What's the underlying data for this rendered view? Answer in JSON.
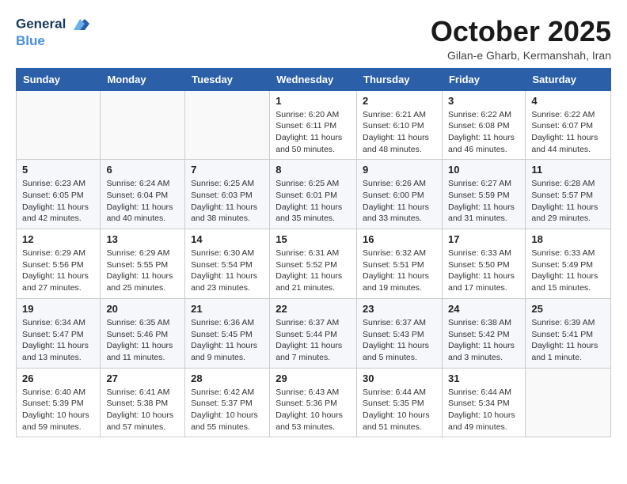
{
  "header": {
    "logo_line1": "General",
    "logo_line2": "Blue",
    "title": "October 2025",
    "subtitle": "Gilan-e Gharb, Kermanshah, Iran"
  },
  "weekdays": [
    "Sunday",
    "Monday",
    "Tuesday",
    "Wednesday",
    "Thursday",
    "Friday",
    "Saturday"
  ],
  "weeks": [
    [
      {
        "day": "",
        "info": ""
      },
      {
        "day": "",
        "info": ""
      },
      {
        "day": "",
        "info": ""
      },
      {
        "day": "1",
        "info": "Sunrise: 6:20 AM\nSunset: 6:11 PM\nDaylight: 11 hours\nand 50 minutes."
      },
      {
        "day": "2",
        "info": "Sunrise: 6:21 AM\nSunset: 6:10 PM\nDaylight: 11 hours\nand 48 minutes."
      },
      {
        "day": "3",
        "info": "Sunrise: 6:22 AM\nSunset: 6:08 PM\nDaylight: 11 hours\nand 46 minutes."
      },
      {
        "day": "4",
        "info": "Sunrise: 6:22 AM\nSunset: 6:07 PM\nDaylight: 11 hours\nand 44 minutes."
      }
    ],
    [
      {
        "day": "5",
        "info": "Sunrise: 6:23 AM\nSunset: 6:05 PM\nDaylight: 11 hours\nand 42 minutes."
      },
      {
        "day": "6",
        "info": "Sunrise: 6:24 AM\nSunset: 6:04 PM\nDaylight: 11 hours\nand 40 minutes."
      },
      {
        "day": "7",
        "info": "Sunrise: 6:25 AM\nSunset: 6:03 PM\nDaylight: 11 hours\nand 38 minutes."
      },
      {
        "day": "8",
        "info": "Sunrise: 6:25 AM\nSunset: 6:01 PM\nDaylight: 11 hours\nand 35 minutes."
      },
      {
        "day": "9",
        "info": "Sunrise: 6:26 AM\nSunset: 6:00 PM\nDaylight: 11 hours\nand 33 minutes."
      },
      {
        "day": "10",
        "info": "Sunrise: 6:27 AM\nSunset: 5:59 PM\nDaylight: 11 hours\nand 31 minutes."
      },
      {
        "day": "11",
        "info": "Sunrise: 6:28 AM\nSunset: 5:57 PM\nDaylight: 11 hours\nand 29 minutes."
      }
    ],
    [
      {
        "day": "12",
        "info": "Sunrise: 6:29 AM\nSunset: 5:56 PM\nDaylight: 11 hours\nand 27 minutes."
      },
      {
        "day": "13",
        "info": "Sunrise: 6:29 AM\nSunset: 5:55 PM\nDaylight: 11 hours\nand 25 minutes."
      },
      {
        "day": "14",
        "info": "Sunrise: 6:30 AM\nSunset: 5:54 PM\nDaylight: 11 hours\nand 23 minutes."
      },
      {
        "day": "15",
        "info": "Sunrise: 6:31 AM\nSunset: 5:52 PM\nDaylight: 11 hours\nand 21 minutes."
      },
      {
        "day": "16",
        "info": "Sunrise: 6:32 AM\nSunset: 5:51 PM\nDaylight: 11 hours\nand 19 minutes."
      },
      {
        "day": "17",
        "info": "Sunrise: 6:33 AM\nSunset: 5:50 PM\nDaylight: 11 hours\nand 17 minutes."
      },
      {
        "day": "18",
        "info": "Sunrise: 6:33 AM\nSunset: 5:49 PM\nDaylight: 11 hours\nand 15 minutes."
      }
    ],
    [
      {
        "day": "19",
        "info": "Sunrise: 6:34 AM\nSunset: 5:47 PM\nDaylight: 11 hours\nand 13 minutes."
      },
      {
        "day": "20",
        "info": "Sunrise: 6:35 AM\nSunset: 5:46 PM\nDaylight: 11 hours\nand 11 minutes."
      },
      {
        "day": "21",
        "info": "Sunrise: 6:36 AM\nSunset: 5:45 PM\nDaylight: 11 hours\nand 9 minutes."
      },
      {
        "day": "22",
        "info": "Sunrise: 6:37 AM\nSunset: 5:44 PM\nDaylight: 11 hours\nand 7 minutes."
      },
      {
        "day": "23",
        "info": "Sunrise: 6:37 AM\nSunset: 5:43 PM\nDaylight: 11 hours\nand 5 minutes."
      },
      {
        "day": "24",
        "info": "Sunrise: 6:38 AM\nSunset: 5:42 PM\nDaylight: 11 hours\nand 3 minutes."
      },
      {
        "day": "25",
        "info": "Sunrise: 6:39 AM\nSunset: 5:41 PM\nDaylight: 11 hours\nand 1 minute."
      }
    ],
    [
      {
        "day": "26",
        "info": "Sunrise: 6:40 AM\nSunset: 5:39 PM\nDaylight: 10 hours\nand 59 minutes."
      },
      {
        "day": "27",
        "info": "Sunrise: 6:41 AM\nSunset: 5:38 PM\nDaylight: 10 hours\nand 57 minutes."
      },
      {
        "day": "28",
        "info": "Sunrise: 6:42 AM\nSunset: 5:37 PM\nDaylight: 10 hours\nand 55 minutes."
      },
      {
        "day": "29",
        "info": "Sunrise: 6:43 AM\nSunset: 5:36 PM\nDaylight: 10 hours\nand 53 minutes."
      },
      {
        "day": "30",
        "info": "Sunrise: 6:44 AM\nSunset: 5:35 PM\nDaylight: 10 hours\nand 51 minutes."
      },
      {
        "day": "31",
        "info": "Sunrise: 6:44 AM\nSunset: 5:34 PM\nDaylight: 10 hours\nand 49 minutes."
      },
      {
        "day": "",
        "info": ""
      }
    ]
  ]
}
